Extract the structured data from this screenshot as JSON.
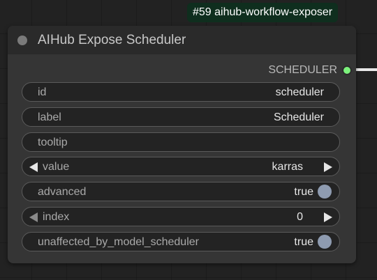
{
  "badge": {
    "text": "#59 aihub-workflow-exposer"
  },
  "node": {
    "title": "AIHub Expose Scheduler",
    "output": {
      "label": "SCHEDULER",
      "connected": true,
      "color": "#7cf27c"
    },
    "widgets": [
      {
        "label": "id",
        "value": "scheduler",
        "kind": "text"
      },
      {
        "label": "label",
        "value": "Scheduler",
        "kind": "text"
      },
      {
        "label": "tooltip",
        "value": "",
        "kind": "text"
      },
      {
        "label": "value",
        "value": "karras",
        "kind": "combo"
      },
      {
        "label": "advanced",
        "value": "true",
        "kind": "toggle"
      },
      {
        "label": "index",
        "value": "0",
        "kind": "number"
      },
      {
        "label": "unaffected_by_model_scheduler",
        "value": "true",
        "kind": "toggle"
      }
    ]
  },
  "colors": {
    "canvas": "#222222",
    "node_body": "#353535",
    "node_title": "#2a2a2a",
    "widget_bg": "#232323",
    "badge_bg": "#0f2e1e",
    "toggle_knob": "#8e9bb0"
  }
}
